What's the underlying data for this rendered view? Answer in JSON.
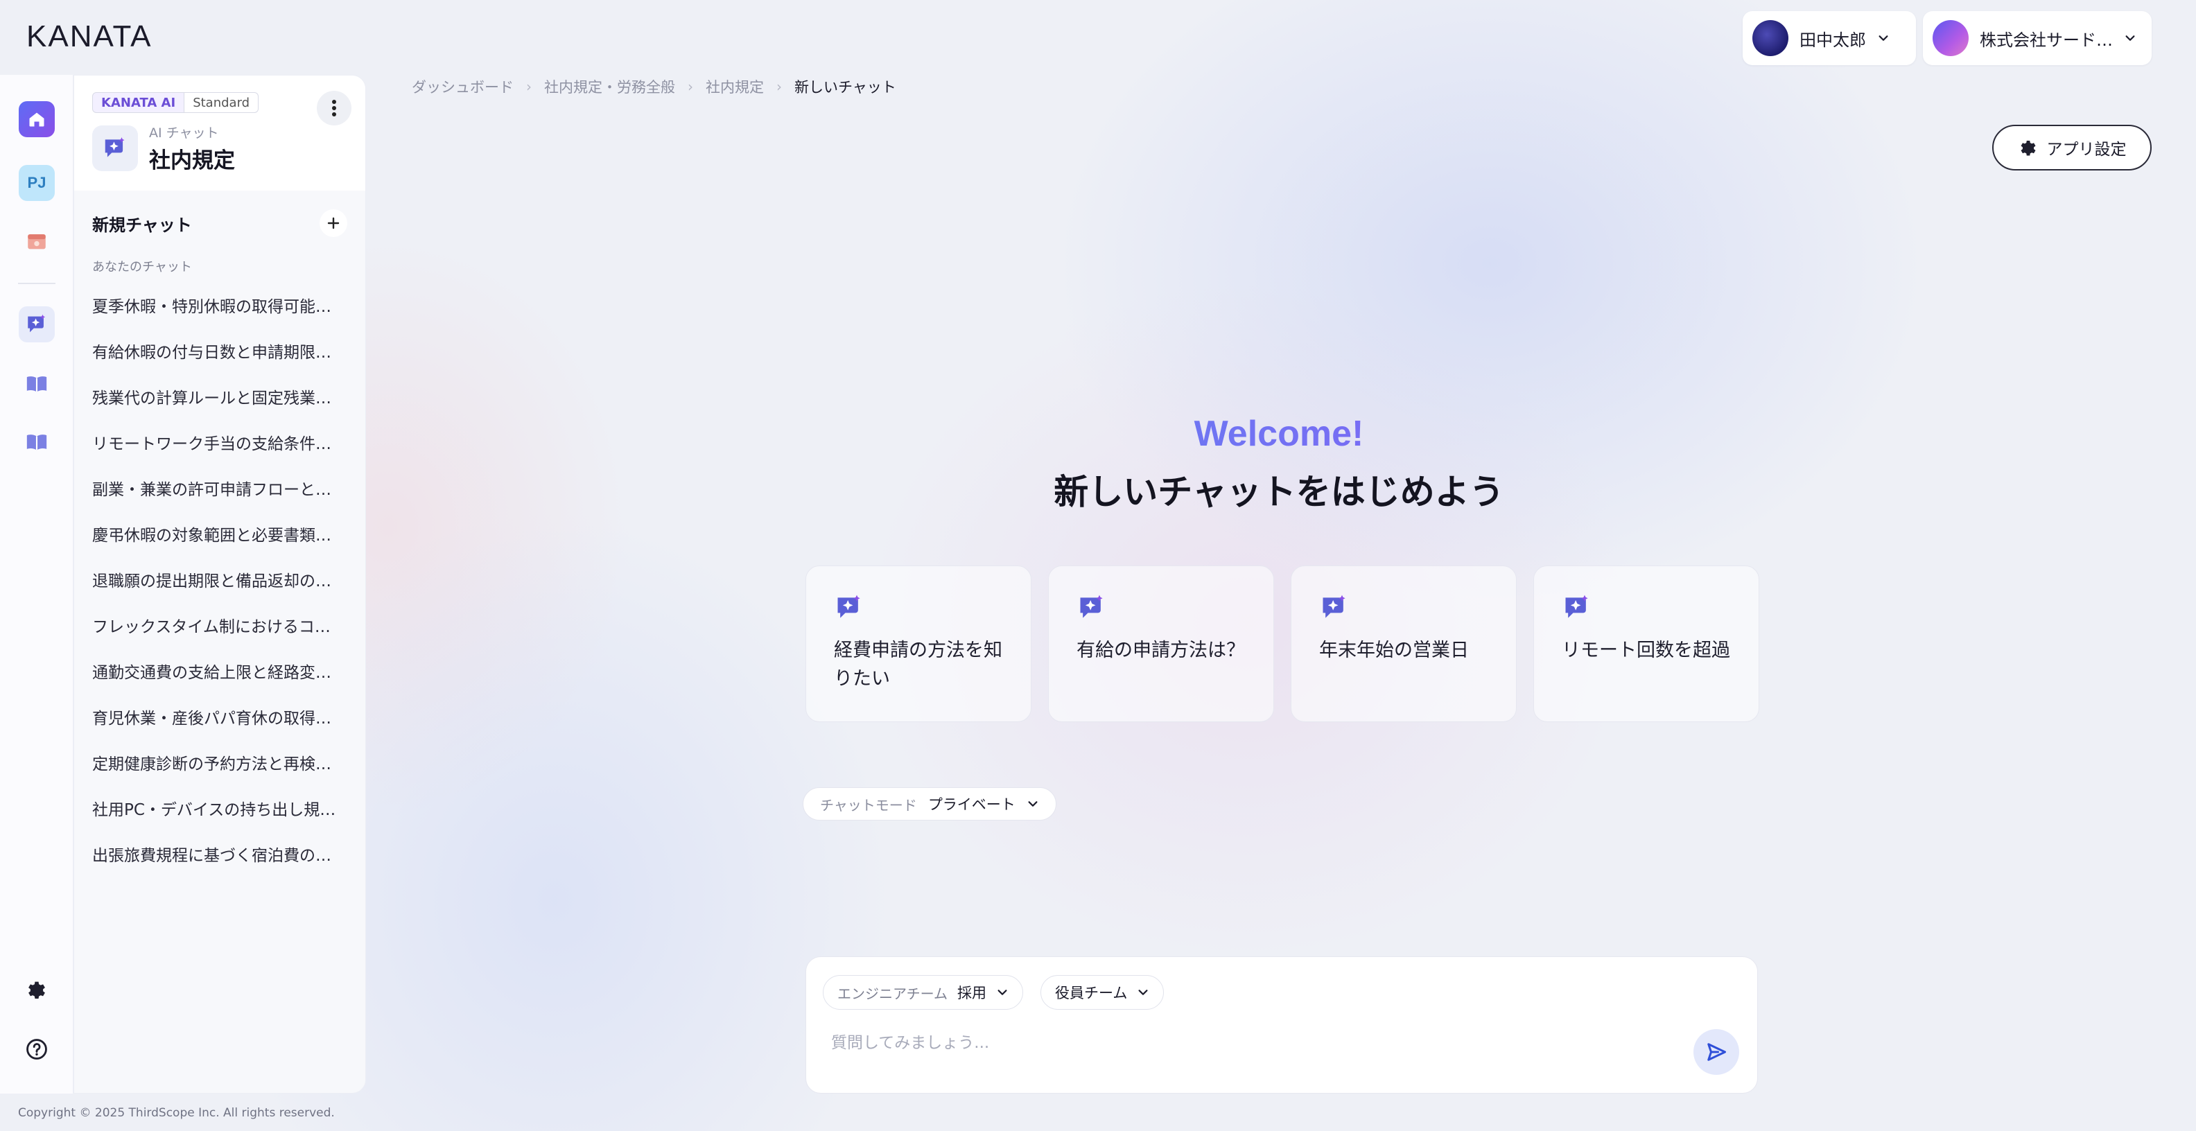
{
  "brand": {
    "logo": "KANATA"
  },
  "header": {
    "user_name": "田中太郎",
    "org_name": "株式会社サード…"
  },
  "rail": {
    "items": [
      "home-icon",
      "project-icon",
      "storage-icon",
      "ai-chat-icon",
      "book-icon",
      "book-icon",
      "gear-icon",
      "help-icon"
    ],
    "project_badge": "PJ"
  },
  "sidebar": {
    "tag_product": "KANATA AI",
    "tag_plan": "Standard",
    "app_subtitle": "AI チャット",
    "app_name": "社内規定",
    "new_chat_label": "新規チャット",
    "section_label": "あなたのチャット",
    "chats": [
      "夏季休暇・特別休暇の取得可能…",
      "有給休暇の付与日数と申請期限…",
      "残業代の計算ルールと固定残業…",
      "リモートワーク手当の支給条件…",
      "副業・兼業の許可申請フローと…",
      "慶弔休暇の対象範囲と必要書類…",
      "退職願の提出期限と備品返却の…",
      "フレックスタイム制におけるコ…",
      "通勤交通費の支給上限と経路変…",
      "育児休業・産後パパ育休の取得…",
      "定期健康診断の予約方法と再検…",
      "社用PC・デバイスの持ち出し規…",
      "出張旅費規程に基づく宿泊費の…"
    ]
  },
  "breadcrumb": [
    "ダッシュボード",
    "社内規定・労務全般",
    "社内規定",
    "新しいチャット"
  ],
  "settings_button": "アプリ設定",
  "hero": {
    "welcome": "Welcome!",
    "title": "新しいチャットをはじめよう"
  },
  "suggestions": [
    "経費申請の方法を知りたい",
    "有給の申請方法は？",
    "年末年始の営業日",
    "リモート回数を超過"
  ],
  "chat_mode": {
    "label": "チャットモード",
    "value": "プライベート"
  },
  "composer": {
    "scope1_label": "エンジニアチーム",
    "scope1_value": "採用",
    "scope2_value": "役員チーム",
    "placeholder": "質問してみましょう..."
  },
  "footer": {
    "copyright": "Copyright © 2025 ThirdScope Inc. All rights reserved."
  },
  "colors": {
    "accent": "#6b4ed6",
    "send": "#2f4fd8",
    "page_bg": "#eef0f6"
  }
}
